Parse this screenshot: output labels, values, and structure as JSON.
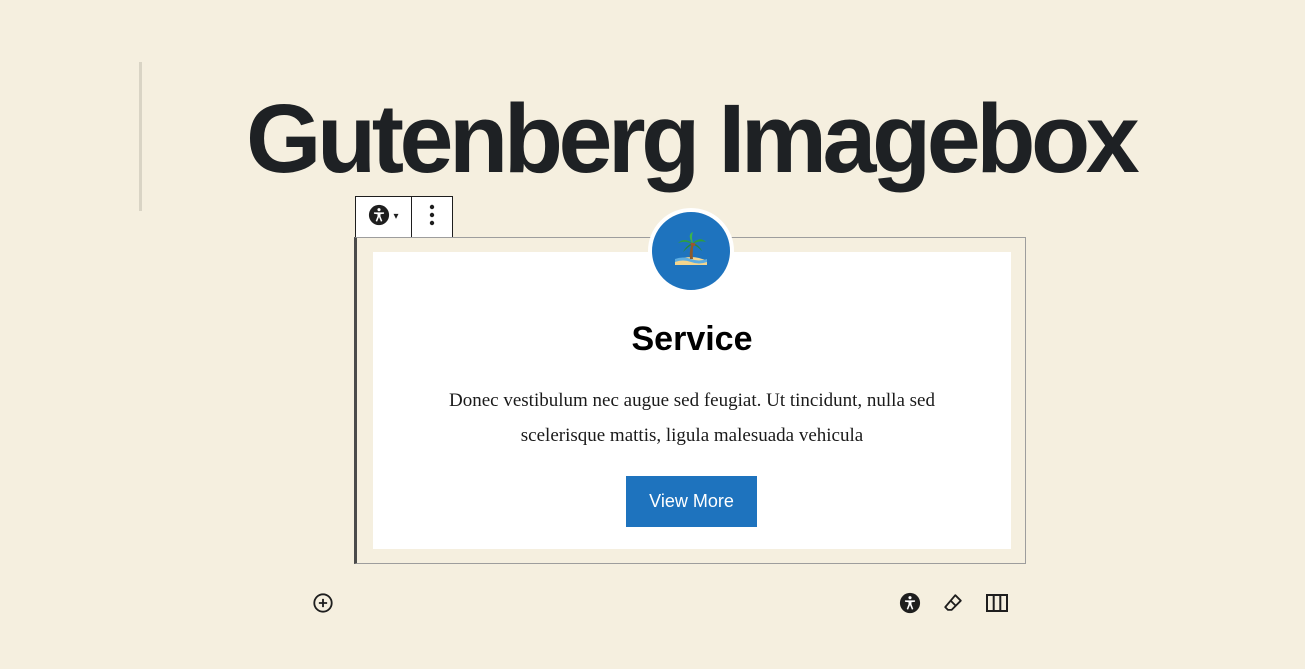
{
  "page": {
    "title": "Gutenberg Imagebox"
  },
  "block_toolbar": {
    "switcher_icon": "accessibility-icon",
    "caret": "▾",
    "more_icon": "more-vertical-icon"
  },
  "imagebox": {
    "icon": "palm-tree-island-icon",
    "title": "Service",
    "description": "Donec vestibulum nec augue sed feugiat. Ut tincidunt, nulla sed scelerisque mattis, ligula malesuada vehicula",
    "button_label": "View More"
  },
  "bottom_toolbar": {
    "add_icon": "add-block-icon",
    "right_icons": [
      "accessibility-icon",
      "eraser-icon",
      "columns-icon"
    ]
  },
  "colors": {
    "background": "#f5efdf",
    "accent": "#1e73be",
    "title": "#1e2124",
    "card": "#ffffff"
  }
}
